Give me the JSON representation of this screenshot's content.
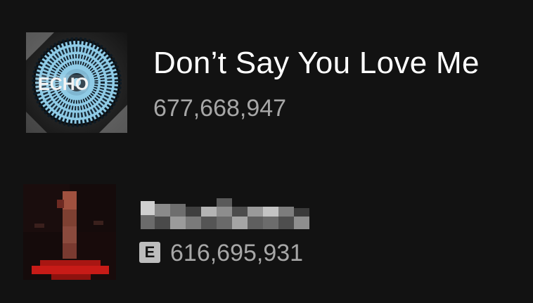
{
  "tracks": [
    {
      "title": "Don’t Say You Love Me",
      "plays": "677,668,947",
      "cover_text": "ECHO",
      "explicit": false
    },
    {
      "title": "",
      "plays": "616,695,931",
      "explicit_label": "E",
      "explicit": true
    }
  ],
  "colors": {
    "background": "#121212",
    "title": "#ffffff",
    "secondary_text": "#a7a7a7",
    "explicit_badge": "#bdbdbd"
  }
}
